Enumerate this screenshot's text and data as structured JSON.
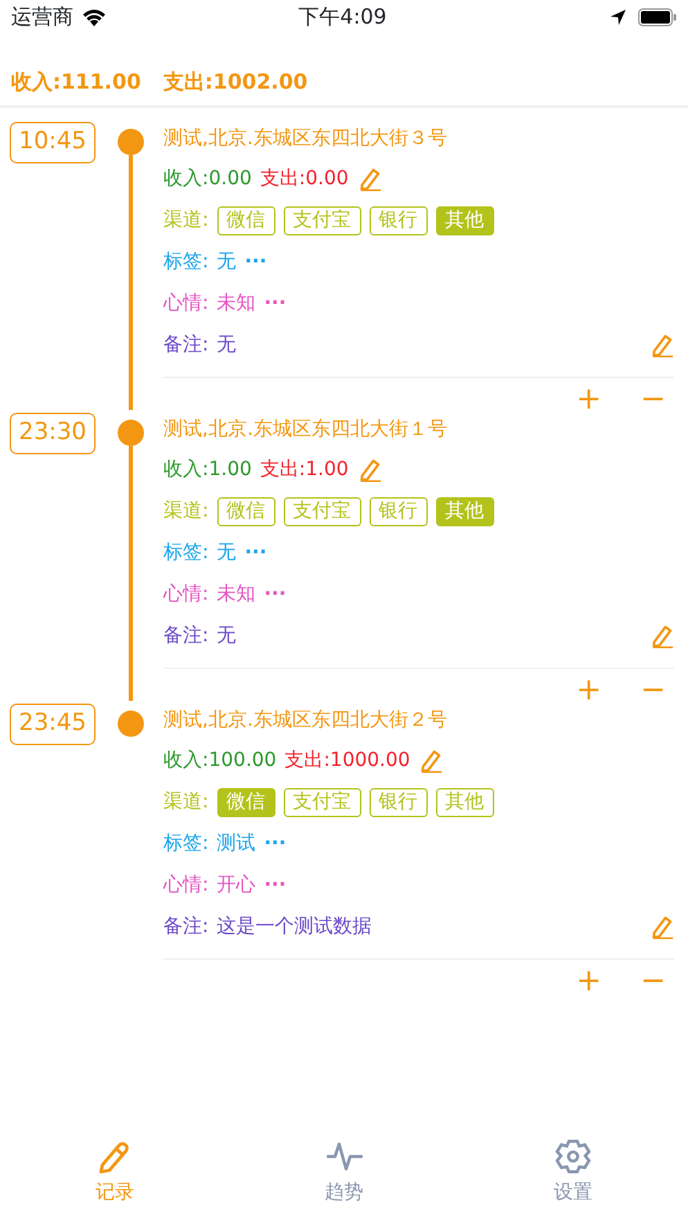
{
  "status_bar": {
    "carrier": "运营商",
    "time": "下午4:09"
  },
  "summary": {
    "income": "收入:111.00",
    "expense": "支出:1002.00"
  },
  "records": [
    {
      "time": "10:45",
      "title": "测试,北京.东城区东四北大街３号",
      "income": "收入:0.00",
      "expense": "支出:0.00",
      "channel_label": "渠道:",
      "channels": [
        {
          "label": "微信",
          "selected": false
        },
        {
          "label": "支付宝",
          "selected": false
        },
        {
          "label": "银行",
          "selected": false
        },
        {
          "label": "其他",
          "selected": true
        }
      ],
      "tag_label": "标签:",
      "tag": "无",
      "tag_more": "···",
      "mood_label": "心情:",
      "mood": "未知",
      "mood_more": "···",
      "note_label": "备注:",
      "note": "无",
      "add": "+",
      "remove": "−"
    },
    {
      "time": "23:30",
      "title": "测试,北京.东城区东四北大街１号",
      "income": "收入:1.00",
      "expense": "支出:1.00",
      "channel_label": "渠道:",
      "channels": [
        {
          "label": "微信",
          "selected": false
        },
        {
          "label": "支付宝",
          "selected": false
        },
        {
          "label": "银行",
          "selected": false
        },
        {
          "label": "其他",
          "selected": true
        }
      ],
      "tag_label": "标签:",
      "tag": "无",
      "tag_more": "···",
      "mood_label": "心情:",
      "mood": "未知",
      "mood_more": "···",
      "note_label": "备注:",
      "note": "无",
      "add": "+",
      "remove": "−"
    },
    {
      "time": "23:45",
      "title": "测试,北京.东城区东四北大街２号",
      "income": "收入:100.00",
      "expense": "支出:1000.00",
      "channel_label": "渠道:",
      "channels": [
        {
          "label": "微信",
          "selected": true
        },
        {
          "label": "支付宝",
          "selected": false
        },
        {
          "label": "银行",
          "selected": false
        },
        {
          "label": "其他",
          "selected": false
        }
      ],
      "tag_label": "标签:",
      "tag": "测试",
      "tag_more": "···",
      "mood_label": "心情:",
      "mood": "开心",
      "mood_more": "···",
      "note_label": "备注:",
      "note": "这是一个测试数据",
      "add": "+",
      "remove": "−"
    }
  ],
  "tabs": [
    {
      "label": "记录",
      "kind": "pencil",
      "selected": true
    },
    {
      "label": "趋势",
      "kind": "trend",
      "selected": false
    },
    {
      "label": "设置",
      "kind": "gear",
      "selected": false
    }
  ]
}
